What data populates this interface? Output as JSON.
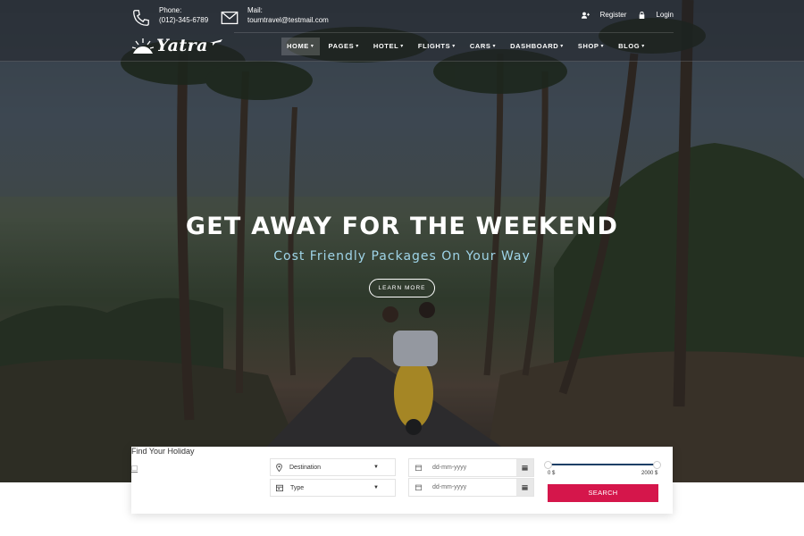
{
  "header": {
    "phone_label": "Phone:",
    "phone_value": "(012)-345-6789",
    "mail_label": "Mail:",
    "mail_value": "tourntravel@testmail.com",
    "register_label": "Register",
    "login_label": "Login"
  },
  "logo": {
    "text": "Yatra"
  },
  "nav": {
    "items": [
      {
        "label": "HOME",
        "active": true
      },
      {
        "label": "PAGES"
      },
      {
        "label": "HOTEL"
      },
      {
        "label": "FLIGHTS"
      },
      {
        "label": "CARS"
      },
      {
        "label": "DASHBOARD"
      },
      {
        "label": "SHOP"
      },
      {
        "label": "BLOG"
      }
    ]
  },
  "hero": {
    "headline": "GET AWAY FOR THE WEEKEND",
    "subline": "Cost Friendly Packages On Your Way",
    "cta_label": "LEARN MORE"
  },
  "search": {
    "title": "Find Your Holiday",
    "destination_label": "Destination",
    "type_label": "Type",
    "date_placeholder_1": "dd-mm-yyyy",
    "date_placeholder_2": "dd-mm-yyyy",
    "price_min": "0 $",
    "price_max": "2000 $",
    "price_range_fraction": [
      0.0,
      1.0
    ],
    "search_label": "SEARCH"
  },
  "colors": {
    "accent_red": "#d5164b",
    "slider_blue": "#1c3f66",
    "subline_blue": "#9fd4e8"
  }
}
